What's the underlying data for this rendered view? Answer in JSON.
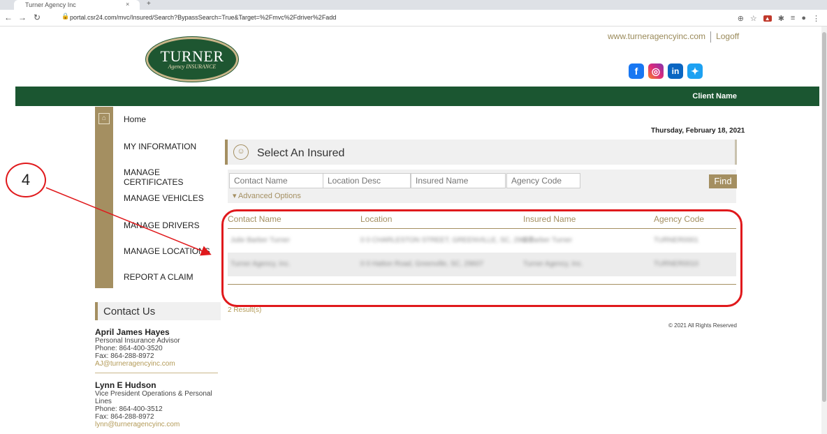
{
  "browser": {
    "tab_title": "Turner Agency Inc",
    "url": "portal.csr24.com/mvc/Insured/Search?BypassSearch=True&Target=%2Fmvc%2Fdriver%2Fadd"
  },
  "header": {
    "logo_big": "TURNER",
    "logo_small": "Agency INSURANCE",
    "site_link": "www.turneragencyinc.com",
    "logoff": "Logoff",
    "client_name": "Client Name"
  },
  "sidebar": {
    "items": [
      {
        "label": "Home"
      },
      {
        "label": "MY INFORMATION"
      },
      {
        "label": "MANAGE CERTIFICATES"
      },
      {
        "label": "MANAGE VEHICLES"
      },
      {
        "label": "MANAGE DRIVERS"
      },
      {
        "label": "MANAGE LOCATIONS"
      },
      {
        "label": "REPORT A CLAIM"
      }
    ]
  },
  "contact": {
    "title": "Contact Us",
    "people": [
      {
        "name": "April James Hayes",
        "role": "Personal Insurance Advisor",
        "phone": "Phone: 864-400-3520",
        "fax": "Fax: 864-288-8972",
        "email": "AJ@turneragencyinc.com"
      },
      {
        "name": "Lynn E Hudson",
        "role": "Vice President Operations & Personal Lines",
        "phone": "Phone: 864-400-3512",
        "fax": "Fax: 864-288-8972",
        "email": "lynn@turneragencyinc.com"
      }
    ]
  },
  "main": {
    "date": "Thursday, February 18, 2021",
    "panel_title": "Select An Insured",
    "search": {
      "contact_name": "Contact Name",
      "location_desc": "Location Desc",
      "insured_name": "Insured Name",
      "agency_code": "Agency Code",
      "find": "Find",
      "advanced": "▾ Advanced Options"
    },
    "columns": [
      "Contact Name",
      "Location",
      "Insured Name",
      "Agency Code"
    ],
    "rows": [
      [
        "Julie Barber Turner",
        "0 0 CHARLESTON STREET, GREENVILLE, SC, 29607",
        "0 Barber Turner",
        "TURNER0001"
      ],
      [
        "Turner Agency, Inc.",
        "0 0 Hatton Road, Greenville, SC, 29607",
        "Turner Agency, Inc.",
        "TURNER0010"
      ]
    ],
    "result_count": "2 Result(s)",
    "copyright": "© 2021 All Rights Reserved"
  },
  "annotation": {
    "callout_number": "4"
  },
  "colors": {
    "brand_green": "#1b5631",
    "gold": "#a48f61",
    "annotation_red": "#e0191c"
  }
}
